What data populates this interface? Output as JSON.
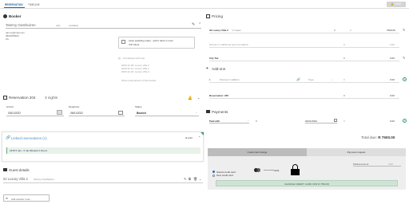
{
  "tabs": [
    {
      "label": "RESERVATION"
    },
    {
      "label": "TIMELINE"
    }
  ],
  "save_label": "SAVE",
  "booker": {
    "title": "Booker",
    "name": "Tammy Oosthuizen",
    "badges": [
      "(24)",
      "Available"
    ],
    "email": "tammy@mail.com",
    "phone": "0829255663",
    "country": "ZA",
    "note": "Likes sparkling water - add it back in room",
    "vip_label": "VIP Client",
    "history_title": "6 bookings (All time)",
    "history": [
      "2023-11-06: Luxury Villa 2",
      "2023-11-11: Luxury Villa 1",
      "2023-11-20: Luxury Villa 2"
    ],
    "show_reservations": "Show reservations of this booker"
  },
  "reservation": {
    "title": "Reservation 204",
    "nights": "3 nights",
    "arrival_label": "Arrival",
    "departure_label": "Departure",
    "status_label": "Status",
    "arrival": "03/01/2022",
    "departure": "06/01/2022",
    "status": "Booked"
  },
  "linked": {
    "title": "Linked reservations (1)",
    "add_label": "Add",
    "item": "2315  5 Jan - 6 Jan  Booked  1 Room"
  },
  "guests": {
    "title": "Guest details",
    "room": "02 Luxury Villa 2",
    "guest": "Tammy Oosthuizen"
  },
  "add_another_room": "Add another room",
  "pricing": {
    "title": "Pricing",
    "room": "02 Luxury Villa 2",
    "room_guests": "1 Guest",
    "room_qty": "3",
    "room_price": "7500.00",
    "discount_label": "Discount / additional accommodation",
    "discount_qty": "0",
    "discount_price": "0.00",
    "citytax_label": "City Tax",
    "citytax_qty": "0",
    "citytax_price": "0.00"
  },
  "addons": {
    "title": "Add-ons",
    "qty": "1",
    "placeholder": "Discount / addition",
    "type_label": "Type",
    "price": "0",
    "total": "0.00"
  },
  "reservation_row": {
    "label": "Reservation: 205",
    "qty": "0",
    "total": "0.00"
  },
  "payments": {
    "title": "Payments",
    "method": "Paid with",
    "amount": "0",
    "date": "04/01/2022",
    "qty": "0",
    "total": "0.00"
  },
  "total_due_label": "Total due:",
  "total_due": "R 7500.00",
  "card": {
    "tabs": [
      "Credit card charge",
      "Payment request"
    ],
    "partial_label": "Partial amount",
    "partial_value": "0.00",
    "stored": "Stored credit card",
    "new_card": "New credit card",
    "masked": "************4444",
    "charge_label": "CHARGE CREDIT CARD FOR R 7500.00"
  }
}
